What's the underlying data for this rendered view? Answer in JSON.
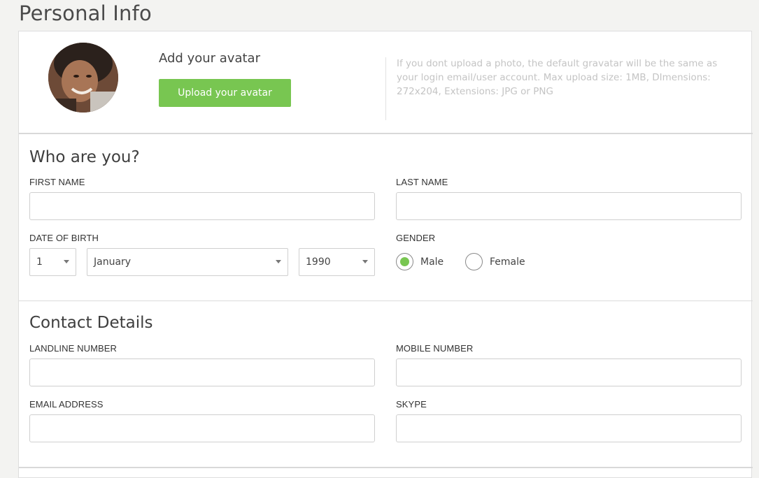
{
  "page": {
    "title": "Personal Info"
  },
  "avatar": {
    "heading": "Add your avatar",
    "upload_label": "Upload your avatar",
    "help_text": "If you dont upload a photo, the default gravatar will be the same as your login email/user account. Max upload size: 1MB, DImensions: 272x204, Extensions: JPG or PNG",
    "button_color": "#78c651"
  },
  "who": {
    "title": "Who are you?",
    "first_name_label": "FIRST NAME",
    "first_name_value": "",
    "last_name_label": "LAST NAME",
    "last_name_value": "",
    "dob_label": "DATE OF BIRTH",
    "dob_day": "1",
    "dob_month": "January",
    "dob_year": "1990",
    "gender_label": "GENDER",
    "gender_options": [
      "Male",
      "Female"
    ],
    "gender_selected": "Male"
  },
  "contact": {
    "title": "Contact Details",
    "landline_label": "LANDLINE NUMBER",
    "landline_value": "",
    "mobile_label": "MOBILE NUMBER",
    "mobile_value": "",
    "email_label": "EMAIL ADDRESS",
    "email_value": "",
    "skype_label": "SKYPE",
    "skype_value": ""
  },
  "icons": {
    "select_caret": "chevron-down-icon",
    "radio_selected": "radio-checked-icon",
    "radio_unselected": "radio-unchecked-icon"
  }
}
